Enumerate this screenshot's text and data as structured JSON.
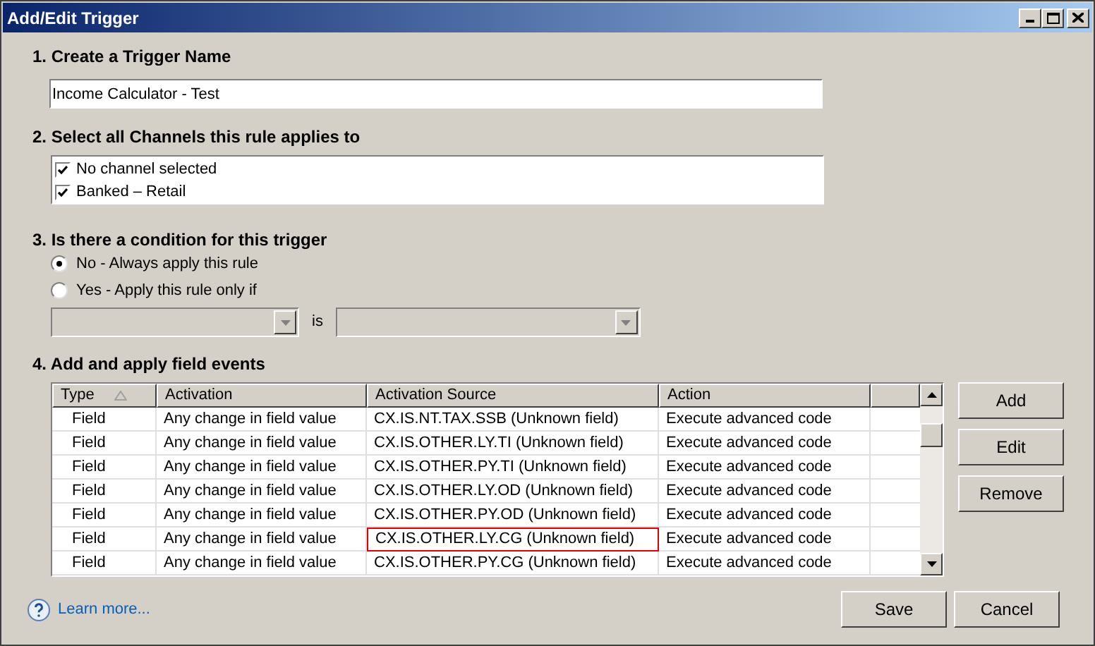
{
  "window": {
    "title": "Add/Edit Trigger"
  },
  "name_section": {
    "heading": "1. Create a Trigger Name",
    "value": "Income Calculator - Test"
  },
  "channels_section": {
    "heading": "2. Select all Channels this rule applies to",
    "channels": [
      {
        "label": "No channel selected",
        "checked": true
      },
      {
        "label": "Banked – Retail",
        "checked": true
      }
    ]
  },
  "condition_section": {
    "heading": "3. Is there a condition for this trigger",
    "options": [
      {
        "label": "No - Always apply this rule",
        "selected": true
      },
      {
        "label": "Yes - Apply this rule only if",
        "selected": false
      }
    ],
    "is_label": "is"
  },
  "events_section": {
    "heading": "4. Add and apply field events",
    "table": {
      "columns": [
        {
          "label": "Type",
          "sorted": true
        },
        {
          "label": "Activation",
          "sorted": false
        },
        {
          "label": "Activation Source",
          "sorted": false
        },
        {
          "label": "Action",
          "sorted": false
        }
      ],
      "rows": [
        {
          "type": "Field",
          "activation": "Any change in field value",
          "source": "CX.IS.NT.TAX.SSB (Unknown field)",
          "action": "Execute advanced code",
          "focused": false
        },
        {
          "type": "Field",
          "activation": "Any change in field value",
          "source": "CX.IS.OTHER.LY.TI (Unknown field)",
          "action": "Execute advanced code",
          "focused": false
        },
        {
          "type": "Field",
          "activation": "Any change in field value",
          "source": "CX.IS.OTHER.PY.TI (Unknown field)",
          "action": "Execute advanced code",
          "focused": false
        },
        {
          "type": "Field",
          "activation": "Any change in field value",
          "source": "CX.IS.OTHER.LY.OD (Unknown field)",
          "action": "Execute advanced code",
          "focused": false
        },
        {
          "type": "Field",
          "activation": "Any change in field value",
          "source": "CX.IS.OTHER.PY.OD (Unknown field)",
          "action": "Execute advanced code",
          "focused": false
        },
        {
          "type": "Field",
          "activation": "Any change in field value",
          "source": "CX.IS.OTHER.LY.CG (Unknown field)",
          "action": "Execute advanced code",
          "focused": true
        },
        {
          "type": "Field",
          "activation": "Any change in field value",
          "source": "CX.IS.OTHER.PY.CG (Unknown field)",
          "action": "Execute advanced code",
          "focused": false
        }
      ]
    },
    "side_buttons": [
      "Add",
      "Edit",
      "Remove"
    ]
  },
  "footer": {
    "link": "Learn more...",
    "buttons": [
      "Save",
      "Cancel"
    ]
  }
}
